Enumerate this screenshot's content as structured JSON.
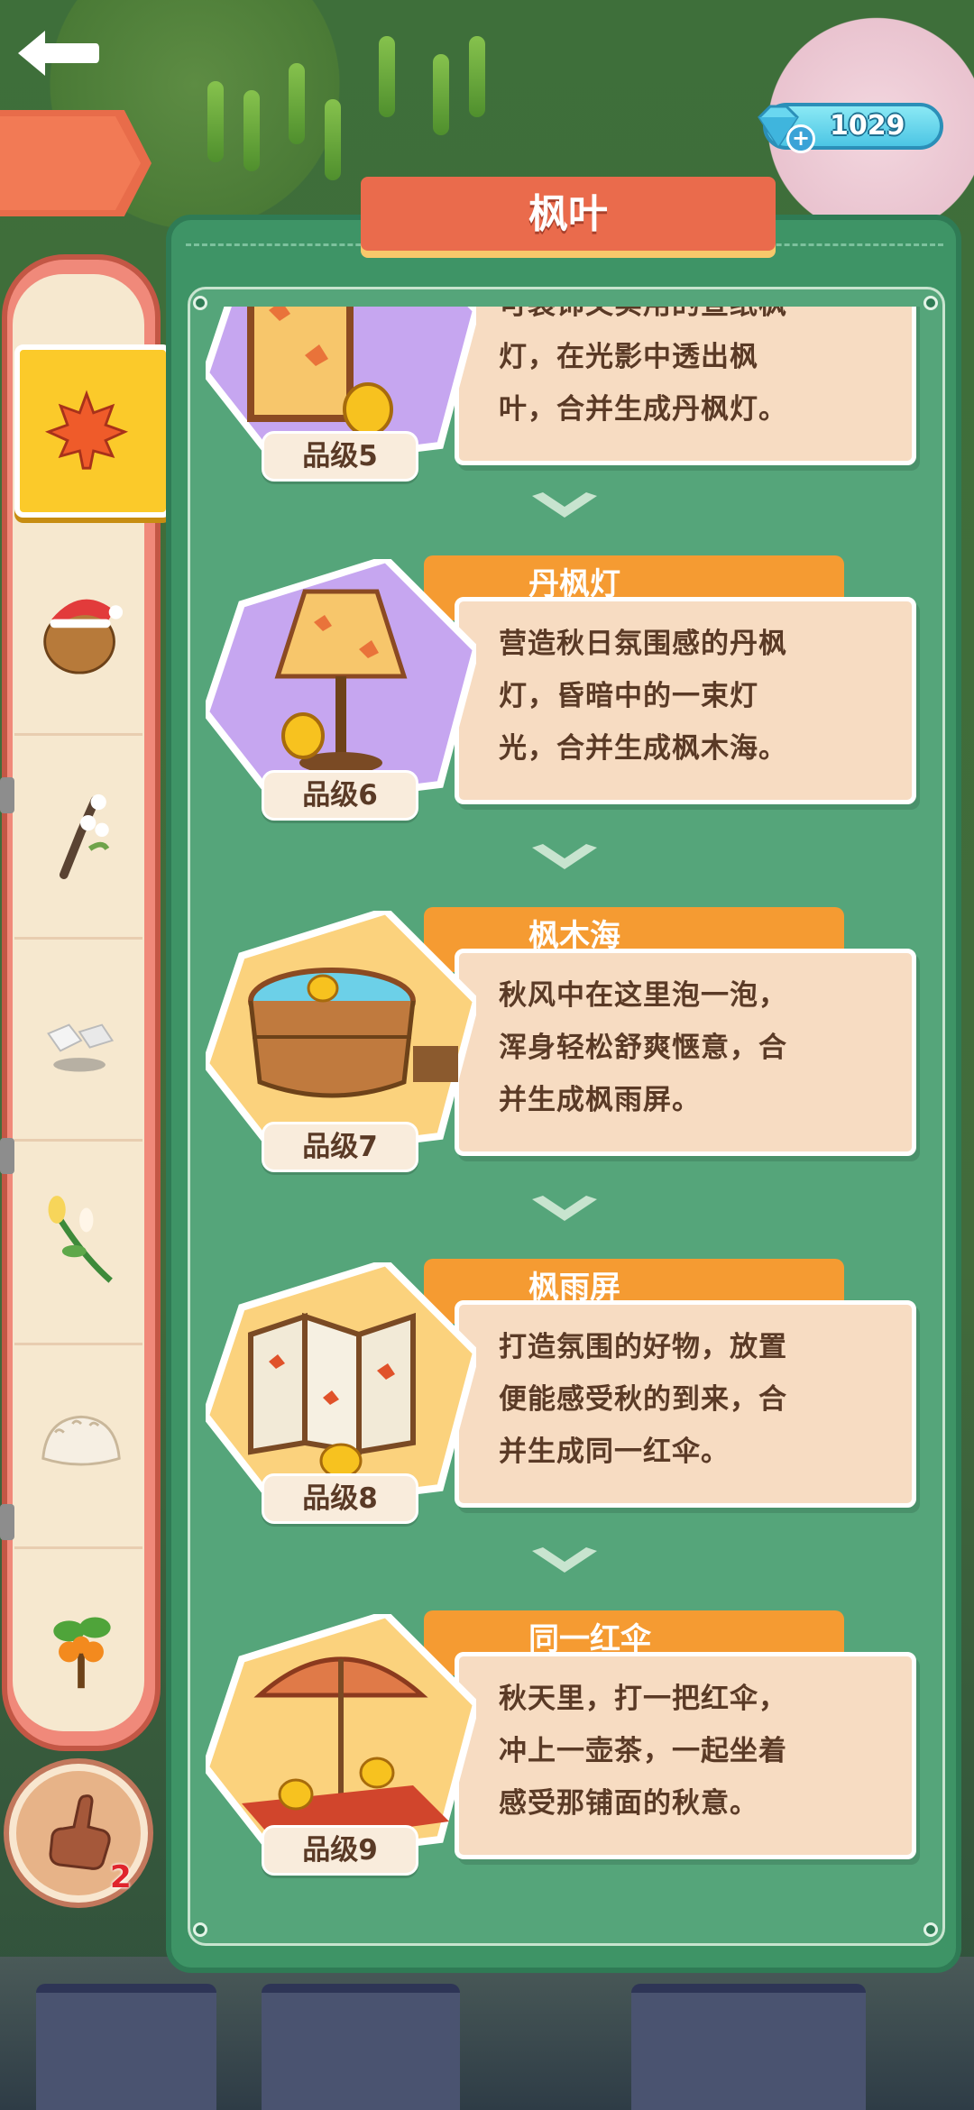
{
  "header": {
    "title": "枫叶"
  },
  "currency": {
    "gems": "1029",
    "plus_icon": "plus-icon",
    "gem_icon": "diamond-icon"
  },
  "hint": {
    "count": "2",
    "icon": "pointing-hand-icon"
  },
  "sidebar": {
    "items": [
      {
        "icon": "maple-leaf-icon",
        "active": true
      },
      {
        "icon": "christmas-potato-icon",
        "active": false
      },
      {
        "icon": "cotton-branch-icon",
        "active": false
      },
      {
        "icon": "sugar-cubes-icon",
        "active": false
      },
      {
        "icon": "flower-sprig-icon",
        "active": false
      },
      {
        "icon": "dumpling-icon",
        "active": false
      },
      {
        "icon": "orange-sapling-icon",
        "active": false
      }
    ]
  },
  "items": [
    {
      "name": "",
      "grade": "品级5",
      "desc": [
        "可装饰又实用的宣纸枫",
        "灯，在光影中透出枫",
        "叶，合并生成丹枫灯。"
      ],
      "art": "paper-lantern"
    },
    {
      "name": "丹枫灯",
      "grade": "品级6",
      "desc": [
        "营造秋日氛围感的丹枫",
        "灯，昏暗中的一束灯",
        "光，合并生成枫木海。"
      ],
      "art": "floor-lamp"
    },
    {
      "name": "枫木海",
      "grade": "品级7",
      "desc": [
        "秋风中在这里泡一泡，",
        "浑身轻松舒爽惬意，合",
        "并生成枫雨屏。"
      ],
      "art": "wooden-bath"
    },
    {
      "name": "枫雨屏",
      "grade": "品级8",
      "desc": [
        "打造氛围的好物，放置",
        "便能感受秋的到来，合",
        "并生成同一红伞。"
      ],
      "art": "folding-screen"
    },
    {
      "name": "同一红伞",
      "grade": "品级9",
      "desc": [
        "秋天里，打一把红伞，",
        "冲上一壶茶，一起坐着",
        "感受那铺面的秋意。"
      ],
      "art": "red-umbrella"
    }
  ],
  "colors": {
    "panel": "#3e9466",
    "tab": "#f59b32",
    "ribbon": "#ea6b4c",
    "desc_bg": "#f7dcc2",
    "active": "#fbca2a"
  }
}
